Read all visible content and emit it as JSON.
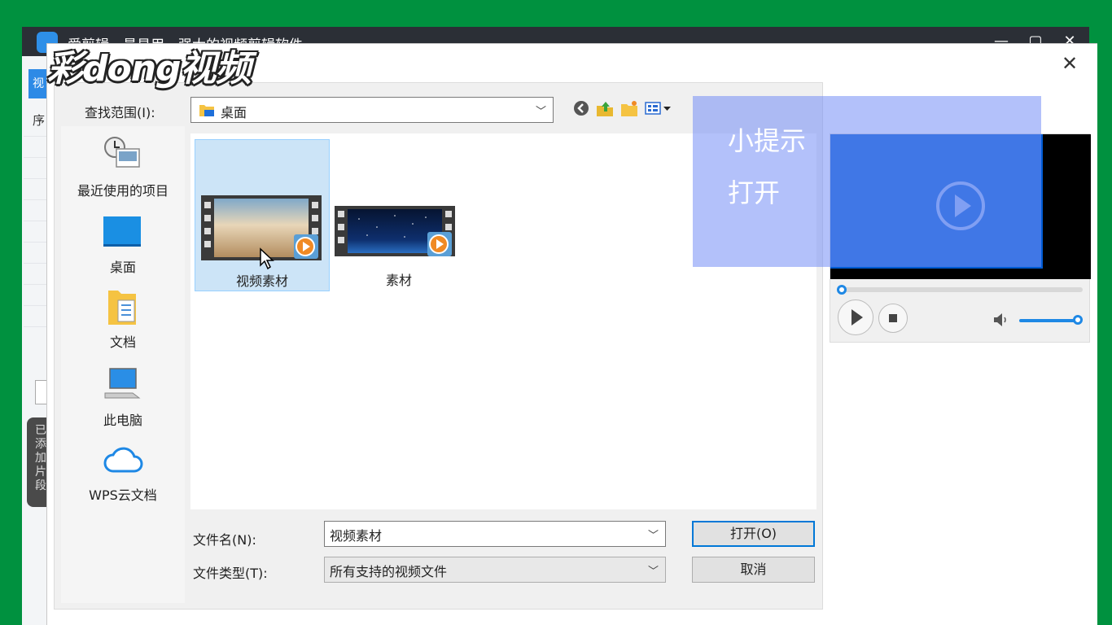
{
  "background_app": {
    "title": "爱剪辑 - 最易用、强大的视频剪辑软件",
    "tab_label": "视",
    "column_header": "序",
    "side_panel_text": "已添加片段"
  },
  "watermark": {
    "text": "彩dong视频"
  },
  "dialog": {
    "close_label": "✕",
    "look_in": {
      "label": "查找范围(I):",
      "value": "桌面"
    },
    "places": [
      {
        "label": "最近使用的项目",
        "icon": "recent-items-icon"
      },
      {
        "label": "桌面",
        "icon": "desktop-icon"
      },
      {
        "label": "文档",
        "icon": "documents-icon"
      },
      {
        "label": "此电脑",
        "icon": "this-pc-icon"
      },
      {
        "label": "WPS云文档",
        "icon": "cloud-icon"
      }
    ],
    "files": [
      {
        "name": "视频素材",
        "selected": true,
        "thumbnail": "desert-clouds"
      },
      {
        "name": "素材",
        "selected": false,
        "thumbnail": "night-sky"
      }
    ],
    "filename": {
      "label": "文件名(N):",
      "value": "视频素材"
    },
    "filetype": {
      "label": "文件类型(T):",
      "value": "所有支持的视频文件"
    },
    "open_button": "打开(O)",
    "cancel_button": "取消"
  },
  "tip": {
    "title": "小提示",
    "text": "打开"
  },
  "colors": {
    "page_background": "#00913f",
    "selection": "#cce4f7",
    "preview_blue": "#005bd3",
    "tip_overlay": "#748ef6",
    "accent": "#1e88e5"
  }
}
